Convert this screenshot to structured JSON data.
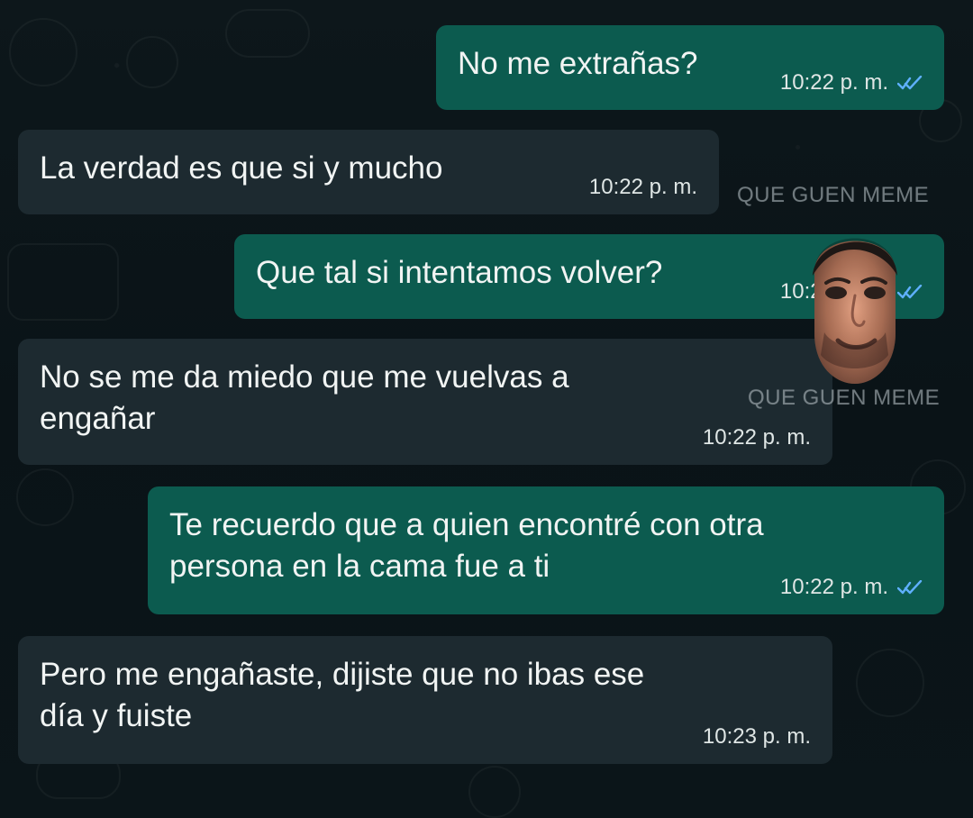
{
  "messages": [
    {
      "id": 1,
      "direction": "outgoing",
      "text": "No me extrañas?",
      "time": "10:22 p. m.",
      "read": true
    },
    {
      "id": 2,
      "direction": "incoming",
      "text": "La verdad es que si y mucho",
      "time": "10:22 p. m."
    },
    {
      "id": 3,
      "direction": "outgoing",
      "text": "Que tal si intentamos volver?",
      "time": "10:22 p. m.",
      "read": true
    },
    {
      "id": 4,
      "direction": "incoming",
      "text": "No se me da miedo que me vuelvas a\nengañar",
      "time": "10:22 p. m."
    },
    {
      "id": 5,
      "direction": "outgoing",
      "text": "Te recuerdo que a quien encontré con otra\npersona en la cama fue a ti",
      "time": "10:22 p. m.",
      "read": true
    },
    {
      "id": 6,
      "direction": "incoming",
      "text": "Pero me engañaste, dijiste que no ibas ese\ndía y fuiste",
      "time": "10:23 p. m."
    }
  ],
  "watermarks": [
    "QUE GUEN MEME",
    "QUE GUEN MEME"
  ],
  "icons": {
    "read_receipt": "double-check-icon",
    "overlay": "face-photo-overlay"
  },
  "colors": {
    "outgoing_bubble": "#0c5b4f",
    "incoming_bubble": "#1d2a30",
    "read_receipt": "#5fb0ff",
    "background": "#0b1418"
  }
}
